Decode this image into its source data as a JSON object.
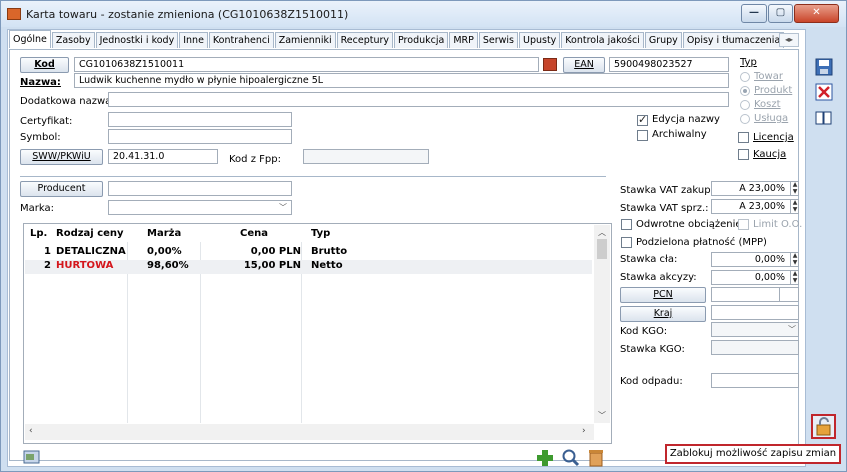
{
  "window": {
    "title": "Karta towaru - zostanie zmieniona (CG1010638Z1510011)",
    "accent": "#c0262c"
  },
  "tabs": [
    "Ogólne",
    "Zasoby",
    "Jednostki i kody",
    "Inne",
    "Kontrahenci",
    "Zamienniki",
    "Receptury",
    "Produkcja",
    "MRP",
    "Serwis",
    "Upusty",
    "Kontrola jakości",
    "Grupy",
    "Opisy i tłumaczenia"
  ],
  "form": {
    "kod_button": "Kod",
    "kod_value": "CG1010638Z1510011",
    "ean_button": "EAN",
    "ean_value": "5900498023527",
    "nazwa_label": "Nazwa:",
    "nazwa_value": "Ludwik kuchenne mydło w płynie hipoalergiczne 5L",
    "dodatkowa_label": "Dodatkowa nazwa:",
    "dodatkowa_value": "",
    "certyfikat_label": "Certyfikat:",
    "symbol_label": "Symbol:",
    "sww_button": "SWW/PKWiU",
    "sww_value": "20.41.31.0",
    "kodfpp_label": "Kod z Fpp:",
    "edycja_nazwy": "Edycja nazwy",
    "archiwalny": "Archiwalny",
    "producent_button": "Producent",
    "marka_label": "Marka:"
  },
  "typ": {
    "label": "Typ",
    "options": [
      "Towar",
      "Produkt",
      "Koszt",
      "Usługa"
    ],
    "selected": "Produkt",
    "licencja": "Licencja",
    "kaucja": "Kaucja"
  },
  "vat": {
    "zakupu_label": "Stawka VAT zakupu:",
    "zakupu_value": "A 23,00%",
    "sprz_label": "Stawka VAT sprz.:",
    "sprz_value": "A 23,00%",
    "odwrotne": "Odwrotne obciążenie",
    "limit": "Limit O.O.",
    "podzielona": "Podzielona płatność (MPP)",
    "cla_label": "Stawka cła:",
    "cla_value": "0,00%",
    "akcyzy_label": "Stawka akcyzy:",
    "akcyzy_value": "0,00%",
    "pcn_button": "PCN",
    "kraj_button": "Kraj",
    "kodkgo_label": "Kod KGO:",
    "stawkakgo_label": "Stawka KGO:",
    "kododpadu_label": "Kod odpadu:"
  },
  "prices": {
    "headers": [
      "Lp.",
      "Rodzaj ceny",
      "Marża",
      "Cena",
      "Typ"
    ],
    "rows": [
      {
        "lp": "1",
        "rodzaj": "DETALICZNA",
        "marza": "0,00%",
        "cena": "0,00 PLN",
        "typ": "Brutto",
        "color": "#000000"
      },
      {
        "lp": "2",
        "rodzaj": "HURTOWA",
        "marza": "98,60%",
        "cena": "15,00 PLN",
        "typ": "Netto",
        "color": "#d4161c"
      }
    ]
  },
  "tooltip": "Zablokuj możliwość zapisu zmian"
}
